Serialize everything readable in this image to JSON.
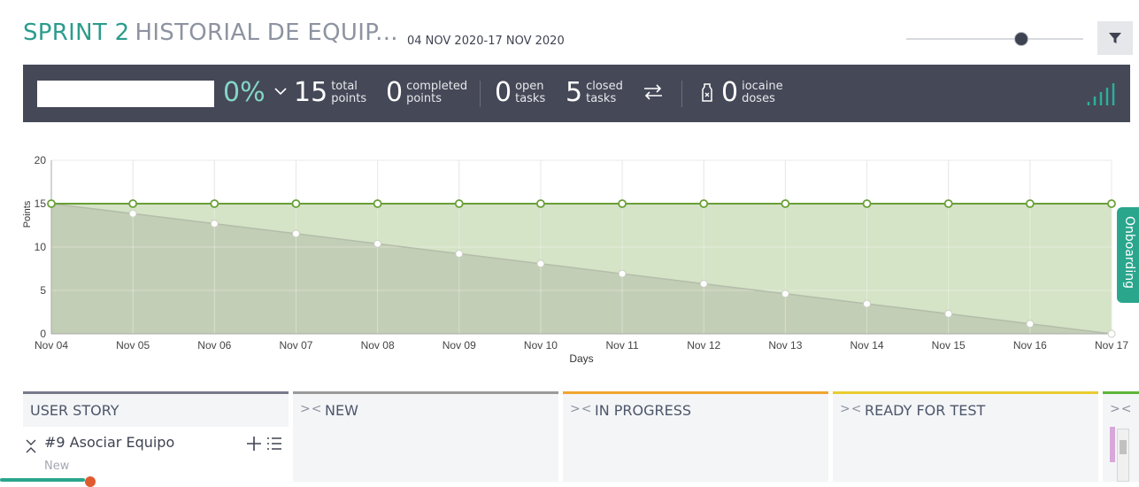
{
  "header": {
    "title_sprint": "SPRINT 2",
    "title_rest": "HISTORIAL DE EQUIP...",
    "date_range": "04 NOV 2020-17 NOV 2020",
    "zoom_level": 0.65
  },
  "stats": {
    "percent": "0%",
    "total_points": {
      "value": "15",
      "label1": "total",
      "label2": "points"
    },
    "completed_points": {
      "value": "0",
      "label1": "completed",
      "label2": "points"
    },
    "open_tasks": {
      "value": "0",
      "label1": "open",
      "label2": "tasks"
    },
    "closed_tasks": {
      "value": "5",
      "label1": "closed",
      "label2": "tasks"
    },
    "iocaine": {
      "value": "0",
      "label1": "iocaine",
      "label2": "doses"
    }
  },
  "chart_data": {
    "type": "area",
    "xlabel": "Days",
    "ylabel": "Points",
    "ylim": [
      0,
      20
    ],
    "yticks": [
      0,
      5,
      10,
      15,
      20
    ],
    "categories": [
      "Nov 04",
      "Nov 05",
      "Nov 06",
      "Nov 07",
      "Nov 08",
      "Nov 09",
      "Nov 10",
      "Nov 11",
      "Nov 12",
      "Nov 13",
      "Nov 14",
      "Nov 15",
      "Nov 16",
      "Nov 17"
    ],
    "series": [
      {
        "values": [
          15,
          15,
          15,
          15,
          15,
          15,
          15,
          15,
          15,
          15,
          15,
          15,
          15,
          15
        ]
      },
      {
        "values": [
          15,
          13.85,
          12.69,
          11.54,
          10.38,
          9.23,
          8.08,
          6.92,
          5.77,
          4.62,
          3.46,
          2.31,
          1.15,
          0
        ]
      }
    ],
    "grid": true,
    "colors": {
      "fill_top": "#d3e2c4",
      "fill_bottom": "#c2ccb5",
      "line_top": "#6aa038",
      "line_bottom": "#b4bdaa"
    }
  },
  "side_tab": {
    "label": "Onboarding"
  },
  "board": {
    "columns": [
      {
        "title": "USER STORY",
        "color": "#777a8a"
      },
      {
        "title": "NEW",
        "color": "#9a9a9a"
      },
      {
        "title": "IN PROGRESS",
        "color": "#f0a530"
      },
      {
        "title": "READY FOR TEST",
        "color": "#e8cc30"
      },
      {
        "title": "",
        "color": "#5fb53a"
      }
    ],
    "fold_symbol": "><",
    "story": {
      "title": "#9 Asociar Equipo",
      "status": "New"
    }
  }
}
